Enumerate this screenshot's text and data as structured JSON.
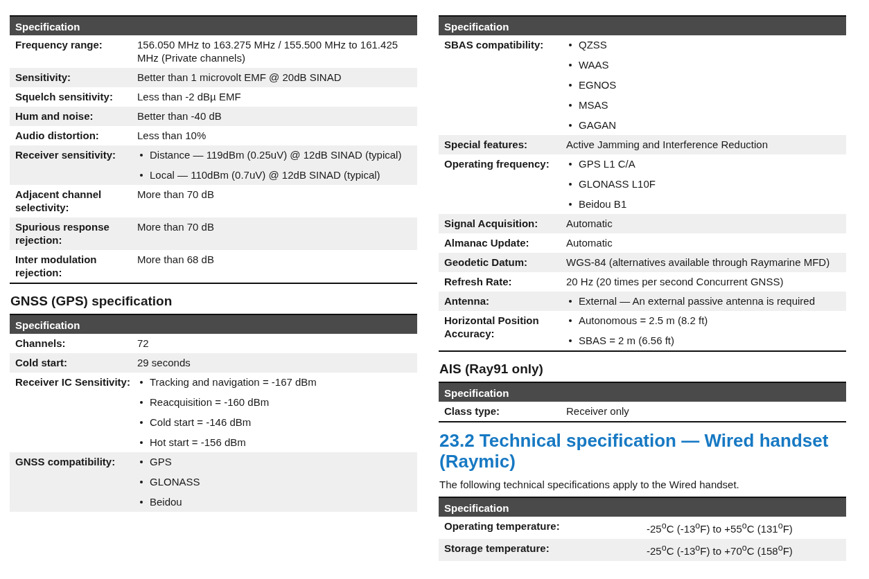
{
  "left": [
    {
      "kind": "table",
      "header": "Specification",
      "rows": [
        {
          "label": "Frequency range:",
          "kind": "text",
          "value": "156.050 MHz to 163.275 MHz / 155.500 MHz to 161.425 MHz (Private channels)"
        },
        {
          "label": "Sensitivity:",
          "kind": "text",
          "value": "Better than 1 microvolt EMF @ 20dB SINAD"
        },
        {
          "label": "Squelch sensitivity:",
          "kind": "text",
          "value": "Less than -2 dBµ EMF"
        },
        {
          "label": "Hum and noise:",
          "kind": "text",
          "value": "Better than -40 dB"
        },
        {
          "label": "Audio distortion:",
          "kind": "text",
          "value": "Less than 10%"
        },
        {
          "label": "Receiver sensitivity:",
          "kind": "list",
          "items": [
            "Distance — 119dBm (0.25uV) @ 12dB SINAD (typical)",
            "Local — 110dBm (0.7uV) @ 12dB SINAD (typical)"
          ]
        },
        {
          "label": "Adjacent channel selectivity:",
          "kind": "text",
          "value": "More than 70 dB"
        },
        {
          "label": "Spurious response rejection:",
          "kind": "text",
          "value": "More than 70 dB"
        },
        {
          "label": "Inter modulation rejection:",
          "kind": "text",
          "value": "More than 68 dB"
        }
      ]
    },
    {
      "kind": "heading",
      "text": "GNSS (GPS) specification"
    },
    {
      "kind": "table",
      "header": "Specification",
      "rows": [
        {
          "label": "Channels:",
          "kind": "text",
          "value": "72"
        },
        {
          "label": "Cold start:",
          "kind": "text",
          "value": "29 seconds"
        },
        {
          "label": "Receiver  IC Sensitivity:",
          "kind": "list",
          "items": [
            "Tracking and navigation = -167  dBm",
            "Reacquisition = -160 dBm",
            "Cold start = -146 dBm",
            "Hot start = -156 dBm"
          ]
        },
        {
          "label": "GNSS compatibility:",
          "kind": "list",
          "items": [
            "GPS",
            "GLONASS",
            "Beidou"
          ]
        }
      ]
    }
  ],
  "right": [
    {
      "kind": "table",
      "header": "Specification",
      "rows": [
        {
          "label": "SBAS compatibility:",
          "kind": "list",
          "items": [
            "QZSS",
            "WAAS",
            "EGNOS",
            "MSAS",
            "GAGAN"
          ]
        },
        {
          "label": "Special features:",
          "kind": "text",
          "value": "Active Jamming and Interference Reduction"
        },
        {
          "label": "Operating frequency:",
          "kind": "list",
          "items": [
            "GPS L1 C/A",
            "GLONASS L10F",
            "Beidou B1"
          ]
        },
        {
          "label": "Signal Acquisition:",
          "kind": "text",
          "value": "Automatic"
        },
        {
          "label": "Almanac Update:",
          "kind": "text",
          "value": "Automatic"
        },
        {
          "label": "Geodetic Datum:",
          "kind": "text",
          "value": "WGS-84 (alternatives available through Raymarine MFD)"
        },
        {
          "label": "Refresh Rate:",
          "kind": "text",
          "value": "20 Hz (20 times per second Concurrent GNSS)"
        },
        {
          "label": "Antenna:",
          "kind": "list",
          "items": [
            "External — An external passive antenna is required"
          ]
        },
        {
          "label": "Horizontal Position Accuracy:",
          "kind": "list",
          "items": [
            "Autonomous = 2.5 m (8.2 ft)",
            "SBAS = 2 m (6.56 ft)"
          ]
        }
      ]
    },
    {
      "kind": "heading",
      "text": "AIS (Ray91 only)"
    },
    {
      "kind": "table",
      "header": "Specification",
      "rows": [
        {
          "label": "Class type:",
          "kind": "text",
          "value": "Receiver only"
        }
      ]
    },
    {
      "kind": "section_title",
      "text": "23.2 Technical specification — Wired handset (Raymic)"
    },
    {
      "kind": "paragraph",
      "text": "The following technical specifications apply to the Wired handset."
    },
    {
      "kind": "wide_table",
      "header": "Specification",
      "rows": [
        {
          "label": "Operating temperature:",
          "kind": "text",
          "value": "-25$^{o}$C (-13$^{o}$F) to +55$^{o}$C (131$^{o}$F)"
        },
        {
          "label": "Storage temperature:",
          "kind": "text",
          "value": "-25$^{o}$C (-13$^{o}$F) to +70$^{o}$C (158$^{o}$F)"
        }
      ]
    }
  ]
}
